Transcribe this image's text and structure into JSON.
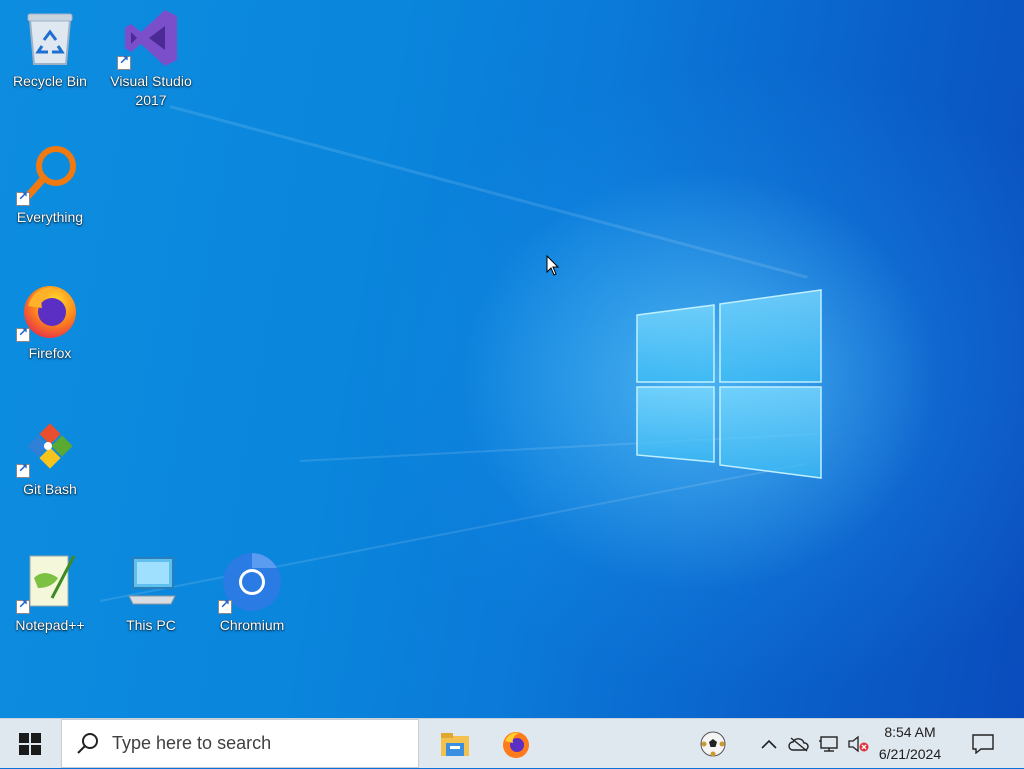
{
  "desktop": {
    "icons": [
      {
        "label": "Recycle Bin"
      },
      {
        "label": "Visual Studio 2017"
      },
      {
        "label": "Everything"
      },
      {
        "label": "Firefox"
      },
      {
        "label": "Git Bash"
      },
      {
        "label": "Notepad++"
      },
      {
        "label": "This PC"
      },
      {
        "label": "Chromium"
      }
    ]
  },
  "taskbar": {
    "search_placeholder": "Type here to search",
    "pinned": [
      "File Explorer",
      "Firefox"
    ],
    "tray": {
      "time": "8:54 AM",
      "date": "6/21/2024"
    }
  },
  "colors": {
    "desktop_blue": "#0a72d8",
    "taskbar_bg": "#dfe7ef",
    "windows_blue": "#0078d7"
  }
}
